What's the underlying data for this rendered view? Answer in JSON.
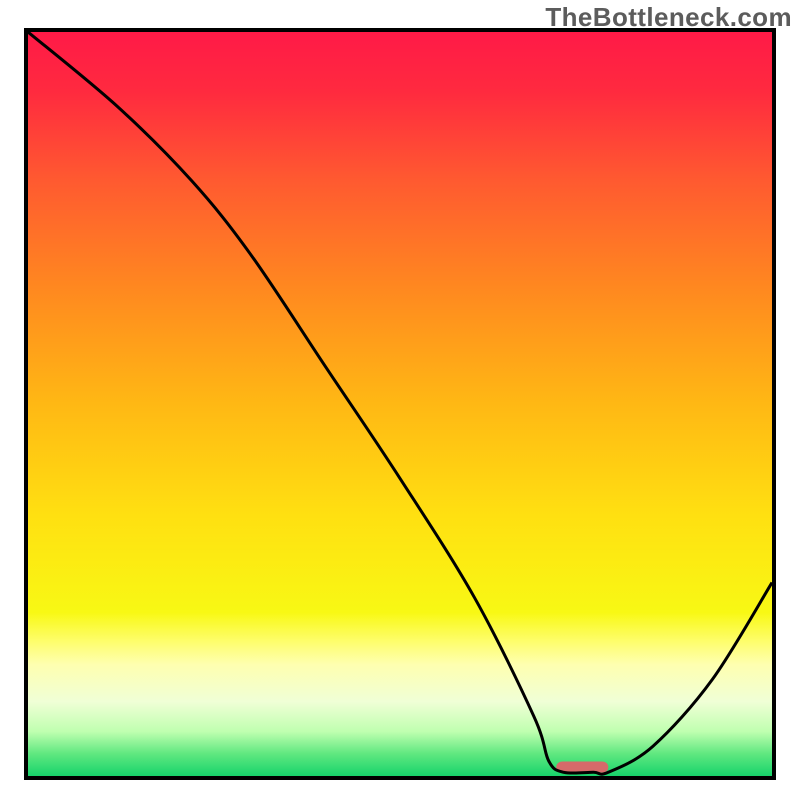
{
  "watermark": "TheBottleneck.com",
  "chart_data": {
    "type": "line",
    "title": "",
    "xlabel": "",
    "ylabel": "",
    "xlim": [
      0,
      100
    ],
    "ylim": [
      0,
      100
    ],
    "series": [
      {
        "name": "curve",
        "x": [
          0,
          12,
          22,
          30,
          40,
          50,
          60,
          68,
          70,
          72,
          76,
          78,
          84,
          92,
          100
        ],
        "values": [
          100,
          90,
          80,
          70,
          55,
          40,
          24,
          8,
          2,
          0.5,
          0.5,
          0.5,
          4,
          13,
          26
        ]
      }
    ],
    "marker": {
      "x_start": 71,
      "x_end": 78,
      "y": 1.2,
      "color": "#d66a6a"
    },
    "gradient_stops": [
      {
        "offset": 0.0,
        "color": "#ff1a47"
      },
      {
        "offset": 0.08,
        "color": "#ff2a3f"
      },
      {
        "offset": 0.2,
        "color": "#ff5a30"
      },
      {
        "offset": 0.35,
        "color": "#ff8a1f"
      },
      {
        "offset": 0.5,
        "color": "#ffb814"
      },
      {
        "offset": 0.65,
        "color": "#ffe011"
      },
      {
        "offset": 0.78,
        "color": "#f8f814"
      },
      {
        "offset": 0.82,
        "color": "#fefe6e"
      },
      {
        "offset": 0.85,
        "color": "#feffb0"
      },
      {
        "offset": 0.9,
        "color": "#f0ffd6"
      },
      {
        "offset": 0.94,
        "color": "#c0ffb0"
      },
      {
        "offset": 0.97,
        "color": "#60e880"
      },
      {
        "offset": 1.0,
        "color": "#17d36b"
      }
    ]
  }
}
